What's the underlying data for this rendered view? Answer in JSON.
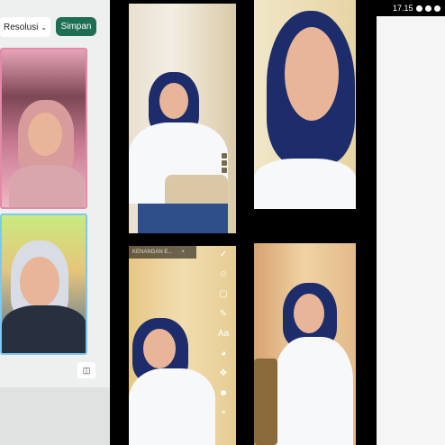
{
  "toolbar": {
    "resolution_label": "Resolusi",
    "save_label": "Simpan"
  },
  "status_bar": {
    "time": "17.15"
  },
  "story": {
    "tag_label": "KENANGAN E...",
    "close_glyph": "×",
    "tools": [
      "✓",
      "☺",
      "▢",
      "✎",
      "Aa",
      "◕",
      "❖",
      "☻",
      "+"
    ]
  },
  "icons": {
    "chevron": "chevron-down-icon",
    "aspect": "aspect-ratio-icon"
  },
  "colors": {
    "save_button": "#1e6e53",
    "editor_background": "#eef0ef",
    "hijab_navy": "#1d2c6a"
  }
}
